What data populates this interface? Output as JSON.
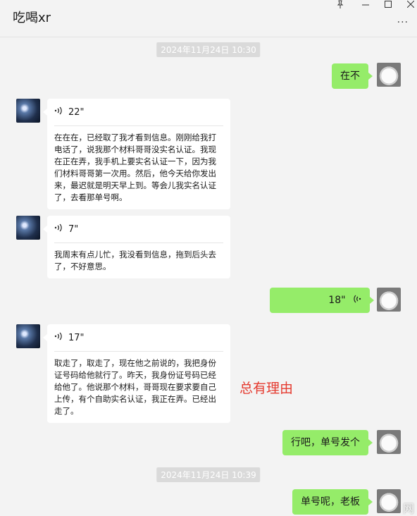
{
  "window": {
    "title": "吃喝xr",
    "more_label": "···",
    "controls": [
      "pin-icon",
      "minimize-icon",
      "maximize-icon",
      "close-icon"
    ]
  },
  "timestamps": [
    "2024年11月24日 10:30",
    "2024年11月24日 10:39"
  ],
  "messages": {
    "m1": {
      "text": "在不"
    },
    "m2": {
      "duration": "22\"",
      "transcript": "在在在，已经取了我才看到信息。刚刚给我打电话了，说我那个材料哥哥没实名认证。我现在正在弄，我手机上要实名认证一下，因为我们材料哥哥第一次用。然后，他今天给你发出来，最迟就是明天早上到。等会儿我实名认证了，去看那单号啊。"
    },
    "m3": {
      "duration": "7\"",
      "transcript": "我周末有点儿忙，我没看到信息，拖到后头去了，不好意思。"
    },
    "m4": {
      "duration": "18\""
    },
    "m5": {
      "duration": "17\"",
      "transcript": "取走了，取走了，现在他之前说的，我把身份证号码给他就行了。昨天，我身份证号码已经给他了。他说那个材料，哥哥现在要求要自己上传，有个自助实名认证，我正在弄。已经出走了。"
    },
    "m6": {
      "text": "行吧，单号发个"
    },
    "m7": {
      "text": "单号呢，老板"
    }
  },
  "annotation": "总有理由",
  "watermark": "网"
}
